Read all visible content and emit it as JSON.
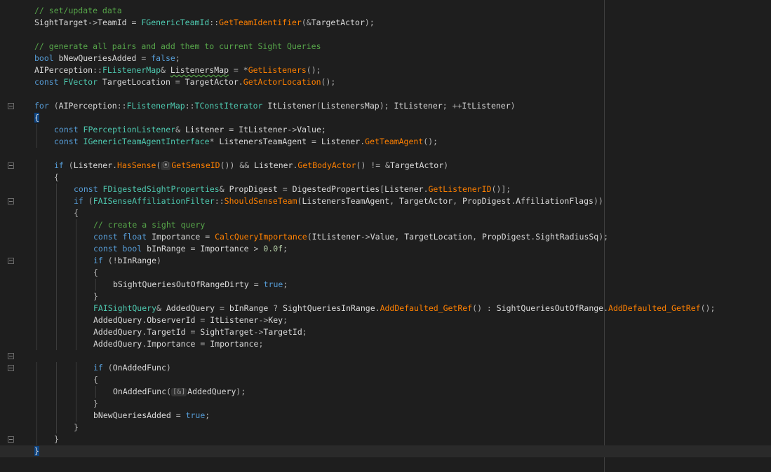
{
  "editor": {
    "language": "C++",
    "colors": {
      "background": "#1e1e1e",
      "comment": "#57a64a",
      "keyword": "#569cd6",
      "type": "#4ec9b0",
      "function": "#ff8000",
      "text": "#dadada"
    },
    "lines": [
      [
        [
          "c",
          "// set/update data"
        ]
      ],
      [
        [
          "v",
          "SightTarget"
        ],
        [
          "p",
          "->"
        ],
        [
          "v",
          "TeamId "
        ],
        [
          "p",
          "= "
        ],
        [
          "t",
          "FGenericTeamId"
        ],
        [
          "p",
          "::"
        ],
        [
          "f",
          "GetTeamIdentifier"
        ],
        [
          "p",
          "(&"
        ],
        [
          "v",
          "TargetActor"
        ],
        [
          "p",
          ");"
        ]
      ],
      [],
      [
        [
          "c",
          "// generate all pairs and add them to current Sight Queries"
        ]
      ],
      [
        [
          "k",
          "bool "
        ],
        [
          "v",
          "bNewQueriesAdded "
        ],
        [
          "p",
          "= "
        ],
        [
          "k",
          "false"
        ],
        [
          "p",
          ";"
        ]
      ],
      [
        [
          "v",
          "AIPerception"
        ],
        [
          "p",
          "::"
        ],
        [
          "t",
          "FListenerMap"
        ],
        [
          "p",
          "& "
        ],
        [
          "sq",
          "ListenersMap"
        ],
        [
          "p",
          " = *"
        ],
        [
          "f",
          "GetListeners"
        ],
        [
          "p",
          "();"
        ]
      ],
      [
        [
          "k",
          "const "
        ],
        [
          "t",
          "FVector "
        ],
        [
          "v",
          "TargetLocation "
        ],
        [
          "p",
          "= "
        ],
        [
          "v",
          "TargetActor"
        ],
        [
          "p",
          "."
        ],
        [
          "f",
          "GetActorLocation"
        ],
        [
          "p",
          "();"
        ]
      ],
      [],
      [
        [
          "k",
          "for "
        ],
        [
          "p",
          "("
        ],
        [
          "v",
          "AIPerception"
        ],
        [
          "p",
          "::"
        ],
        [
          "t",
          "FListenerMap"
        ],
        [
          "p",
          "::"
        ],
        [
          "t",
          "TConstIterator "
        ],
        [
          "v",
          "ItListener"
        ],
        [
          "p",
          "("
        ],
        [
          "v",
          "ListenersMap"
        ],
        [
          "p",
          "); "
        ],
        [
          "v",
          "ItListener"
        ],
        [
          "p",
          "; ++"
        ],
        [
          "v",
          "ItListener"
        ],
        [
          "p",
          ")"
        ]
      ],
      [
        [
          "bh",
          "{"
        ]
      ],
      [
        [
          "k",
          "const "
        ],
        [
          "t",
          "FPerceptionListener"
        ],
        [
          "p",
          "& "
        ],
        [
          "v",
          "Listener "
        ],
        [
          "p",
          "= "
        ],
        [
          "v",
          "ItListener"
        ],
        [
          "p",
          "->"
        ],
        [
          "v",
          "Value"
        ],
        [
          "p",
          ";"
        ]
      ],
      [
        [
          "k",
          "const "
        ],
        [
          "t",
          "IGenericTeamAgentInterface"
        ],
        [
          "p",
          "* "
        ],
        [
          "v",
          "ListenersTeamAgent "
        ],
        [
          "p",
          "= "
        ],
        [
          "v",
          "Listener"
        ],
        [
          "p",
          "."
        ],
        [
          "f",
          "GetTeamAgent"
        ],
        [
          "p",
          "();"
        ]
      ],
      [],
      [
        [
          "k",
          "if "
        ],
        [
          "p",
          "("
        ],
        [
          "v",
          "Listener"
        ],
        [
          "p",
          "."
        ],
        [
          "f",
          "HasSense"
        ],
        [
          "p",
          "("
        ],
        [
          "h",
          "⦿"
        ],
        [
          "f",
          "GetSenseID"
        ],
        [
          "p",
          "()) && "
        ],
        [
          "v",
          "Listener"
        ],
        [
          "p",
          "."
        ],
        [
          "f",
          "GetBodyActor"
        ],
        [
          "p",
          "() != &"
        ],
        [
          "v",
          "TargetActor"
        ],
        [
          "p",
          ")"
        ]
      ],
      [
        [
          "p",
          "{"
        ]
      ],
      [
        [
          "k",
          "const "
        ],
        [
          "t",
          "FDigestedSightProperties"
        ],
        [
          "p",
          "& "
        ],
        [
          "v",
          "PropDigest "
        ],
        [
          "p",
          "= "
        ],
        [
          "v",
          "DigestedProperties"
        ],
        [
          "p",
          "["
        ],
        [
          "v",
          "Listener"
        ],
        [
          "p",
          "."
        ],
        [
          "f",
          "GetListenerID"
        ],
        [
          "p",
          "()];"
        ]
      ],
      [
        [
          "k",
          "if "
        ],
        [
          "p",
          "("
        ],
        [
          "t",
          "FAISenseAffiliationFilter"
        ],
        [
          "p",
          "::"
        ],
        [
          "f",
          "ShouldSenseTeam"
        ],
        [
          "p",
          "("
        ],
        [
          "v",
          "ListenersTeamAgent"
        ],
        [
          "p",
          ", "
        ],
        [
          "v",
          "TargetActor"
        ],
        [
          "p",
          ", "
        ],
        [
          "v",
          "PropDigest"
        ],
        [
          "p",
          "."
        ],
        [
          "v",
          "AffiliationFlags"
        ],
        [
          "p",
          "))"
        ]
      ],
      [
        [
          "p",
          "{"
        ]
      ],
      [
        [
          "c",
          "// create a sight query"
        ]
      ],
      [
        [
          "k",
          "const float "
        ],
        [
          "v",
          "Importance "
        ],
        [
          "p",
          "= "
        ],
        [
          "f",
          "CalcQueryImportance"
        ],
        [
          "p",
          "("
        ],
        [
          "v",
          "ItListener"
        ],
        [
          "p",
          "->"
        ],
        [
          "v",
          "Value"
        ],
        [
          "p",
          ", "
        ],
        [
          "v",
          "TargetLocation"
        ],
        [
          "p",
          ", "
        ],
        [
          "v",
          "PropDigest"
        ],
        [
          "p",
          "."
        ],
        [
          "v",
          "SightRadiusSq"
        ],
        [
          "p",
          ");"
        ]
      ],
      [
        [
          "k",
          "const bool "
        ],
        [
          "v",
          "bInRange "
        ],
        [
          "p",
          "= "
        ],
        [
          "v",
          "Importance "
        ],
        [
          "p",
          "> "
        ],
        [
          "n",
          "0.0f"
        ],
        [
          "p",
          ";"
        ]
      ],
      [
        [
          "k",
          "if "
        ],
        [
          "p",
          "(!"
        ],
        [
          "v",
          "bInRange"
        ],
        [
          "p",
          ")"
        ]
      ],
      [
        [
          "p",
          "{"
        ]
      ],
      [
        [
          "v",
          "bSightQueriesOutOfRangeDirty "
        ],
        [
          "p",
          "= "
        ],
        [
          "k",
          "true"
        ],
        [
          "p",
          ";"
        ]
      ],
      [
        [
          "p",
          "}"
        ]
      ],
      [
        [
          "t",
          "FAISightQuery"
        ],
        [
          "p",
          "& "
        ],
        [
          "v",
          "AddedQuery "
        ],
        [
          "p",
          "= "
        ],
        [
          "v",
          "bInRange "
        ],
        [
          "p",
          "? "
        ],
        [
          "v",
          "SightQueriesInRange"
        ],
        [
          "p",
          "."
        ],
        [
          "f",
          "AddDefaulted_GetRef"
        ],
        [
          "p",
          "() : "
        ],
        [
          "v",
          "SightQueriesOutOfRange"
        ],
        [
          "p",
          "."
        ],
        [
          "f",
          "AddDefaulted_GetRef"
        ],
        [
          "p",
          "();"
        ]
      ],
      [
        [
          "v",
          "AddedQuery"
        ],
        [
          "p",
          "."
        ],
        [
          "v",
          "ObserverId "
        ],
        [
          "p",
          "= "
        ],
        [
          "v",
          "ItListener"
        ],
        [
          "p",
          "->"
        ],
        [
          "v",
          "Key"
        ],
        [
          "p",
          ";"
        ]
      ],
      [
        [
          "v",
          "AddedQuery"
        ],
        [
          "p",
          "."
        ],
        [
          "v",
          "TargetId "
        ],
        [
          "p",
          "= "
        ],
        [
          "v",
          "SightTarget"
        ],
        [
          "p",
          "->"
        ],
        [
          "v",
          "TargetId"
        ],
        [
          "p",
          ";"
        ]
      ],
      [
        [
          "v",
          "AddedQuery"
        ],
        [
          "p",
          "."
        ],
        [
          "v",
          "Importance "
        ],
        [
          "p",
          "= "
        ],
        [
          "v",
          "Importance"
        ],
        [
          "p",
          ";"
        ]
      ],
      [],
      [
        [
          "k",
          "if "
        ],
        [
          "p",
          "("
        ],
        [
          "v",
          "OnAddedFunc"
        ],
        [
          "p",
          ")"
        ]
      ],
      [
        [
          "p",
          "{"
        ]
      ],
      [
        [
          "v",
          "OnAddedFunc"
        ],
        [
          "p",
          "("
        ],
        [
          "h",
          "[&]"
        ],
        [
          "v",
          "AddedQuery"
        ],
        [
          "p",
          ");"
        ]
      ],
      [
        [
          "p",
          "}"
        ]
      ],
      [
        [
          "v",
          "bNewQueriesAdded "
        ],
        [
          "p",
          "= "
        ],
        [
          "k",
          "true"
        ],
        [
          "p",
          ";"
        ]
      ],
      [
        [
          "p",
          "}"
        ]
      ],
      [
        [
          "p",
          "}"
        ]
      ],
      [
        [
          "bh",
          "}"
        ]
      ]
    ]
  }
}
